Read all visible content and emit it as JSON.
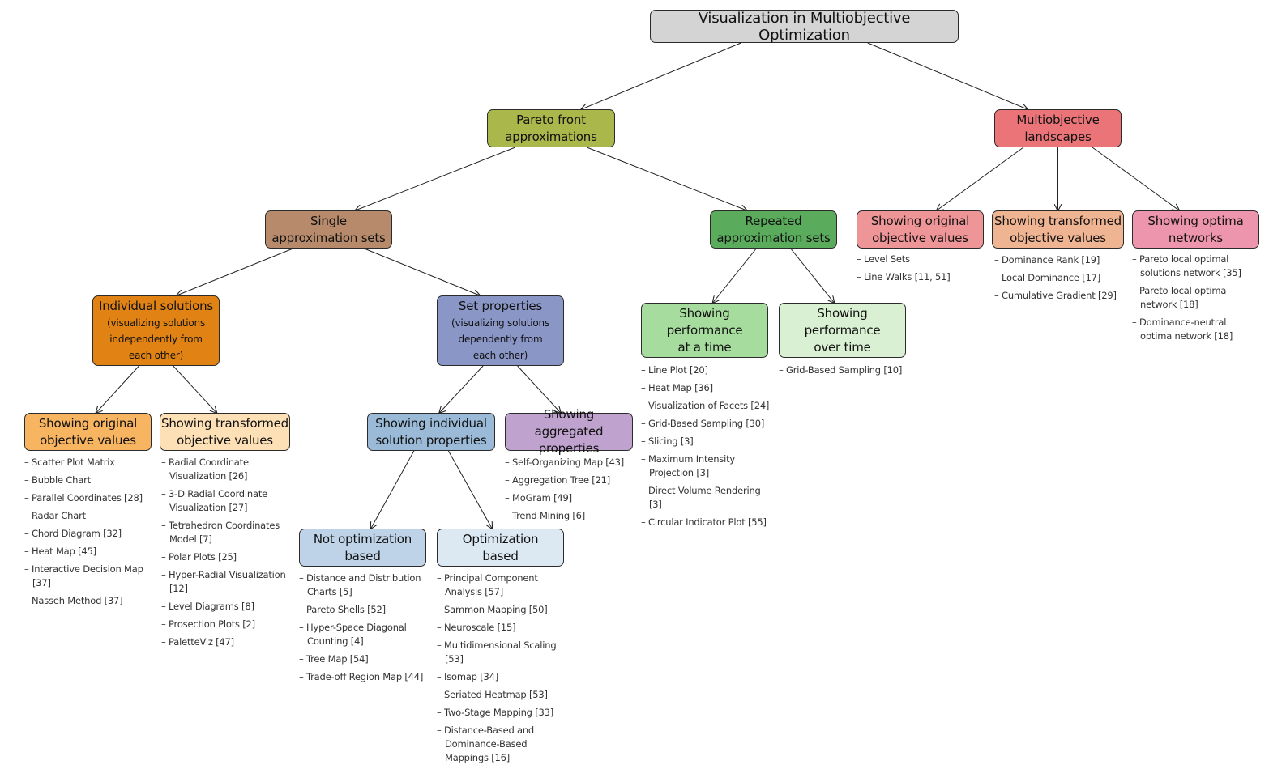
{
  "diagram": {
    "root": {
      "label": "Visualization in Multiobjective Optimization",
      "color": "#d4d4d4"
    },
    "nodes": {
      "pareto": {
        "label": "Pareto front approximations",
        "color": "#aab84b"
      },
      "landscapes": {
        "label": "Multiobjective landscapes",
        "color": "#ea7478"
      },
      "single": {
        "label": "Single approximation sets",
        "color": "#b68a6a"
      },
      "repeated": {
        "label": "Repeated approximation sets",
        "color": "#5aac5c"
      },
      "individual": {
        "label": "Individual solutions",
        "sublabel": "(visualizing solutions independently from each other)",
        "color": "#e08314"
      },
      "setprops": {
        "label": "Set properties",
        "sublabel": "(visualizing solutions dependently from each other)",
        "color": "#8a96c6"
      },
      "ind_original": {
        "label": "Showing original objective values",
        "color": "#f7b461"
      },
      "ind_transformed": {
        "label": "Showing transformed objective values",
        "color": "#fde0b6"
      },
      "sp_individual": {
        "label": "Showing individual solution properties",
        "color": "#9abad8"
      },
      "sp_aggregated": {
        "label": "Showing aggregated properties",
        "color": "#c0a2cf"
      },
      "not_opt": {
        "label": "Not optimization based",
        "color": "#bed3e7"
      },
      "opt": {
        "label": "Optimization based",
        "color": "#dce8f2"
      },
      "perf_at": {
        "label": "Showing performance at a time",
        "color": "#a6dc9d"
      },
      "perf_over": {
        "label": "Showing performance over time",
        "color": "#d9f0d3"
      },
      "ls_original": {
        "label": "Showing original objective values",
        "color": "#ee9597"
      },
      "ls_transformed": {
        "label": "Showing transformed objective values",
        "color": "#efb592"
      },
      "ls_networks": {
        "label": "Showing optima networks",
        "color": "#ee95ae"
      }
    },
    "lists": {
      "ind_original": [
        "Scatter Plot Matrix",
        "Bubble Chart",
        "Parallel Coordinates [28]",
        "Radar Chart",
        "Chord Diagram [32]",
        "Heat Map [45]",
        "Interactive Decision Map [37]",
        "Nasseh Method [37]"
      ],
      "ind_transformed": [
        "Radial Coordinate Visualization [26]",
        "3-D Radial Coordinate Visualization [27]",
        "Tetrahedron Coordinates Model [7]",
        "Polar Plots [25]",
        "Hyper-Radial Visualization [12]",
        "Level Diagrams [8]",
        "Prosection Plots [2]",
        "PaletteViz [47]"
      ],
      "sp_aggregated": [
        "Self-Organizing Map [43]",
        "Aggregation Tree [21]",
        "MoGram [49]",
        "Trend Mining [6]"
      ],
      "not_opt": [
        "Distance and Distribution Charts [5]",
        "Pareto Shells [52]",
        "Hyper-Space Diagonal Counting [4]",
        "Tree Map [54]",
        "Trade-off Region Map [44]"
      ],
      "opt": [
        "Principal Component Analysis [57]",
        "Sammon Mapping [50]",
        "Neuroscale [15]",
        "Multidimensional Scaling [53]",
        "Isomap [34]",
        "Seriated Heatmap [53]",
        "Two-Stage Mapping [33]",
        "Distance-Based and Dominance-Based Mappings [16]"
      ],
      "perf_at": [
        "Line Plot [20]",
        "Heat Map [36]",
        "Visualization of Facets [24]",
        "Grid-Based Sampling [30]",
        "Slicing [3]",
        "Maximum Intensity Projection [3]",
        "Direct Volume Rendering [3]",
        "Circular Indicator Plot [55]"
      ],
      "perf_over": [
        "Grid-Based Sampling [10]"
      ],
      "ls_original": [
        "Level Sets",
        "Line Walks [11, 51]"
      ],
      "ls_transformed": [
        "Dominance Rank [19]",
        "Local Dominance [17]",
        "Cumulative Gradient [29]"
      ],
      "ls_networks": [
        "Pareto local optimal solutions network [35]",
        "Pareto local optima network [18]",
        "Dominance-neutral optima network [18]"
      ]
    },
    "edges": [
      [
        "root",
        "pareto"
      ],
      [
        "root",
        "landscapes"
      ],
      [
        "pareto",
        "single"
      ],
      [
        "pareto",
        "repeated"
      ],
      [
        "single",
        "individual"
      ],
      [
        "single",
        "setprops"
      ],
      [
        "individual",
        "ind_original"
      ],
      [
        "individual",
        "ind_transformed"
      ],
      [
        "setprops",
        "sp_individual"
      ],
      [
        "setprops",
        "sp_aggregated"
      ],
      [
        "sp_individual",
        "not_opt"
      ],
      [
        "sp_individual",
        "opt"
      ],
      [
        "repeated",
        "perf_at"
      ],
      [
        "repeated",
        "perf_over"
      ],
      [
        "landscapes",
        "ls_original"
      ],
      [
        "landscapes",
        "ls_transformed"
      ],
      [
        "landscapes",
        "ls_networks"
      ]
    ]
  }
}
